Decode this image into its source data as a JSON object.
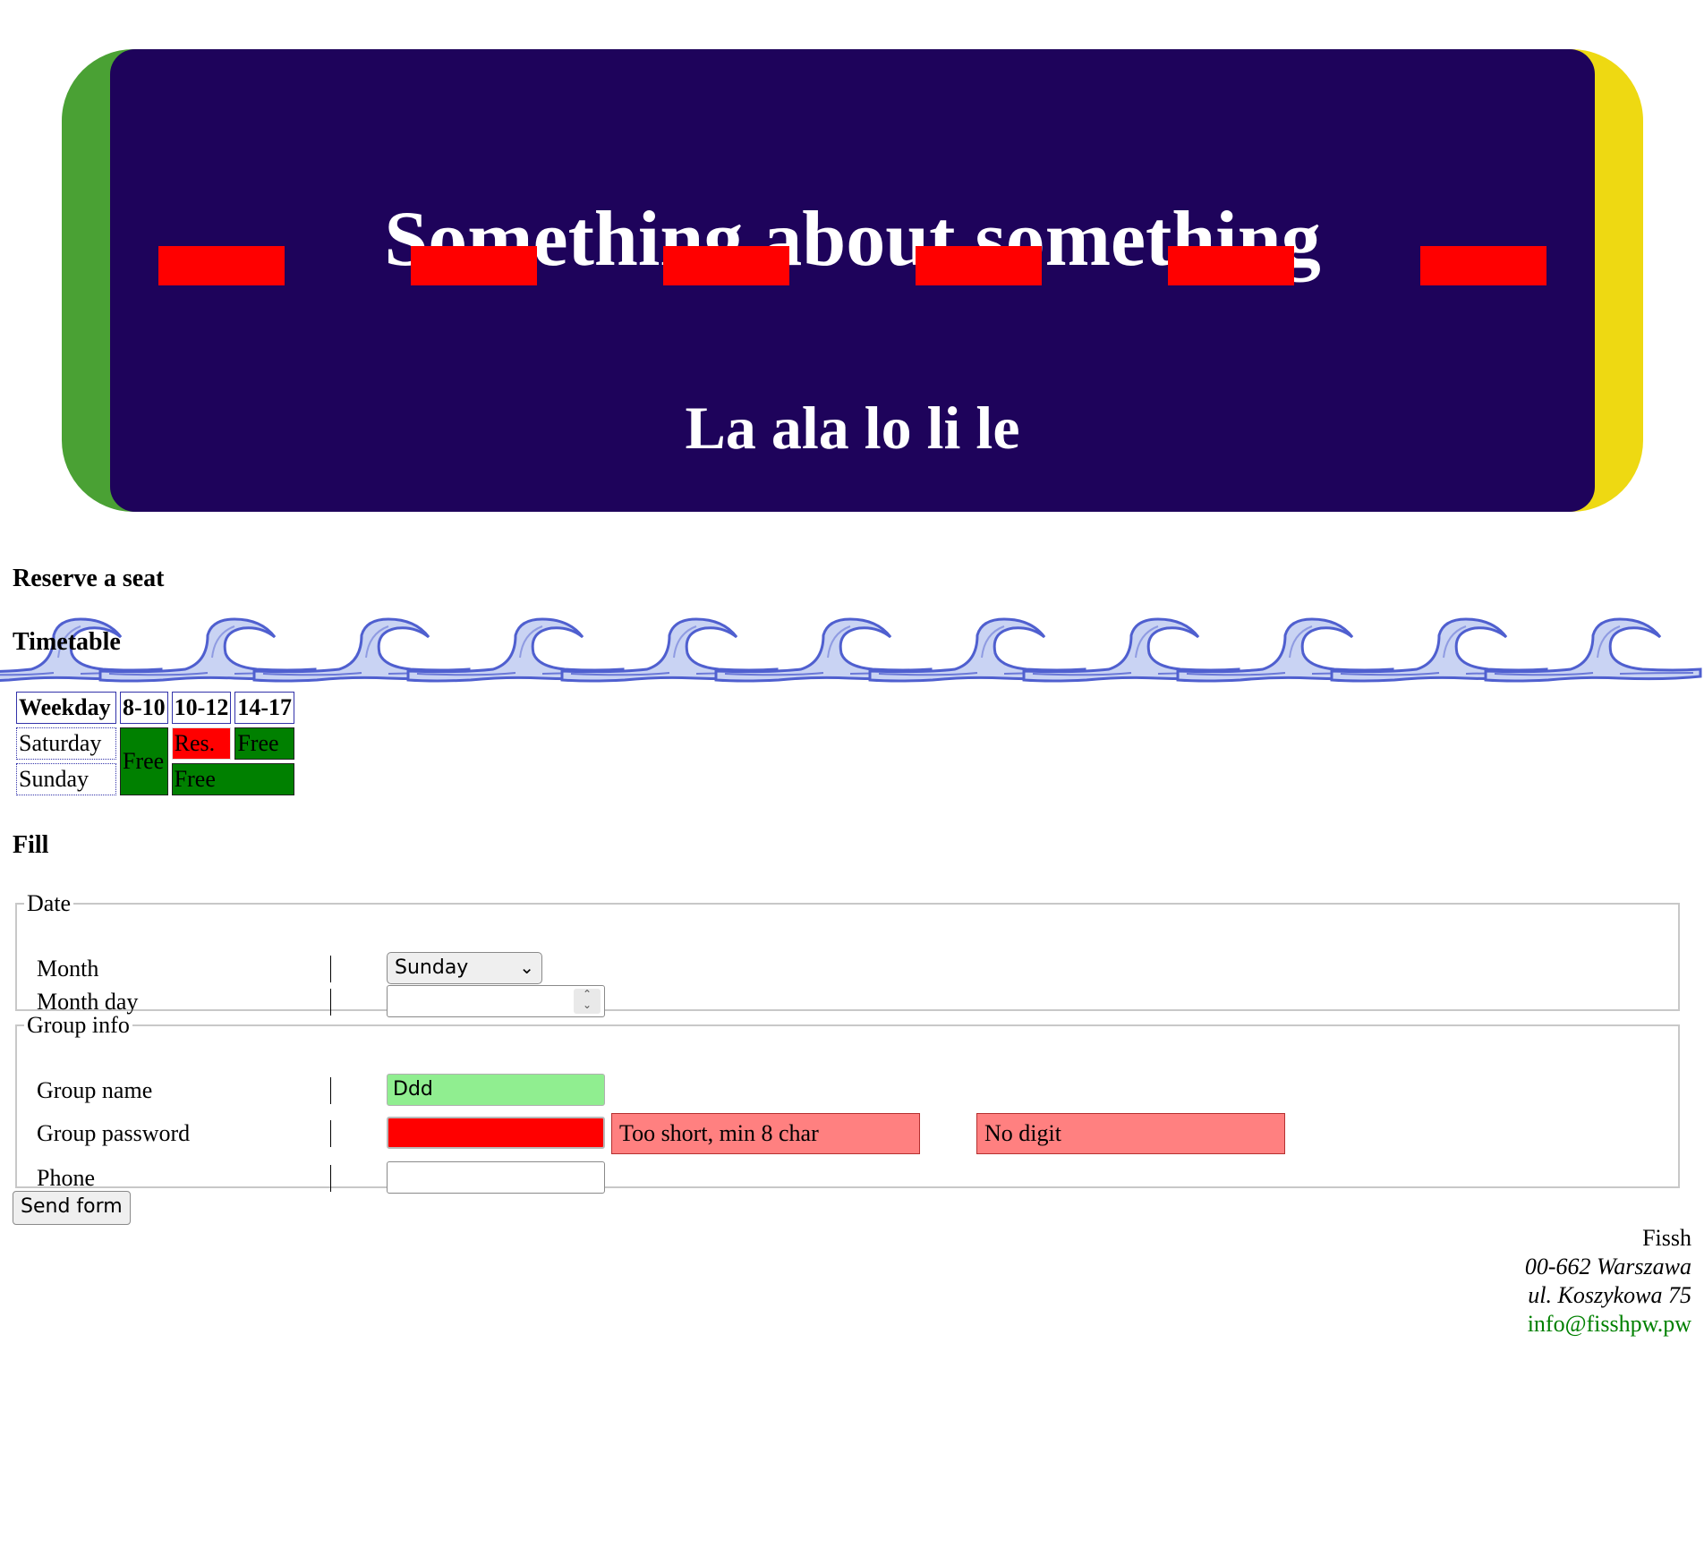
{
  "banner": {
    "title": "Something about something",
    "subtitle": "La ala lo li le",
    "colors": {
      "left_cap": "#4aa134",
      "right_cap": "#eed912",
      "center": "#1e035b",
      "dash": "#ff0000"
    }
  },
  "sections": {
    "reserve": "Reserve a seat",
    "timetable": "Timetable",
    "fill": "Fill"
  },
  "timetable": {
    "headers": [
      "Weekday",
      "8-10",
      "10-12",
      "14-17"
    ],
    "rows": [
      {
        "day": "Saturday",
        "slot_8_10": "Free",
        "slot_10_12": "Res.",
        "slot_14_17": "Free"
      },
      {
        "day": "Sunday",
        "slot_10_17": "Free"
      }
    ]
  },
  "form": {
    "date_legend": "Date",
    "month_label": "Month",
    "month_value": "Sunday",
    "month_day_label": "Month day",
    "month_day_value": "",
    "group_legend": "Group info",
    "group_name_label": "Group name",
    "group_name_value": "Ddd",
    "group_password_label": "Group password",
    "group_password_value": "",
    "password_error_1": "Too short, min 8 char",
    "password_error_2": "No digit",
    "phone_label": "Phone",
    "phone_value": "",
    "submit_label": "Send form"
  },
  "footer": {
    "name": "Fissh",
    "city": "00-662 Warszawa",
    "street": "ul. Koszykowa 75",
    "email": "info@fisshpw.pw"
  }
}
